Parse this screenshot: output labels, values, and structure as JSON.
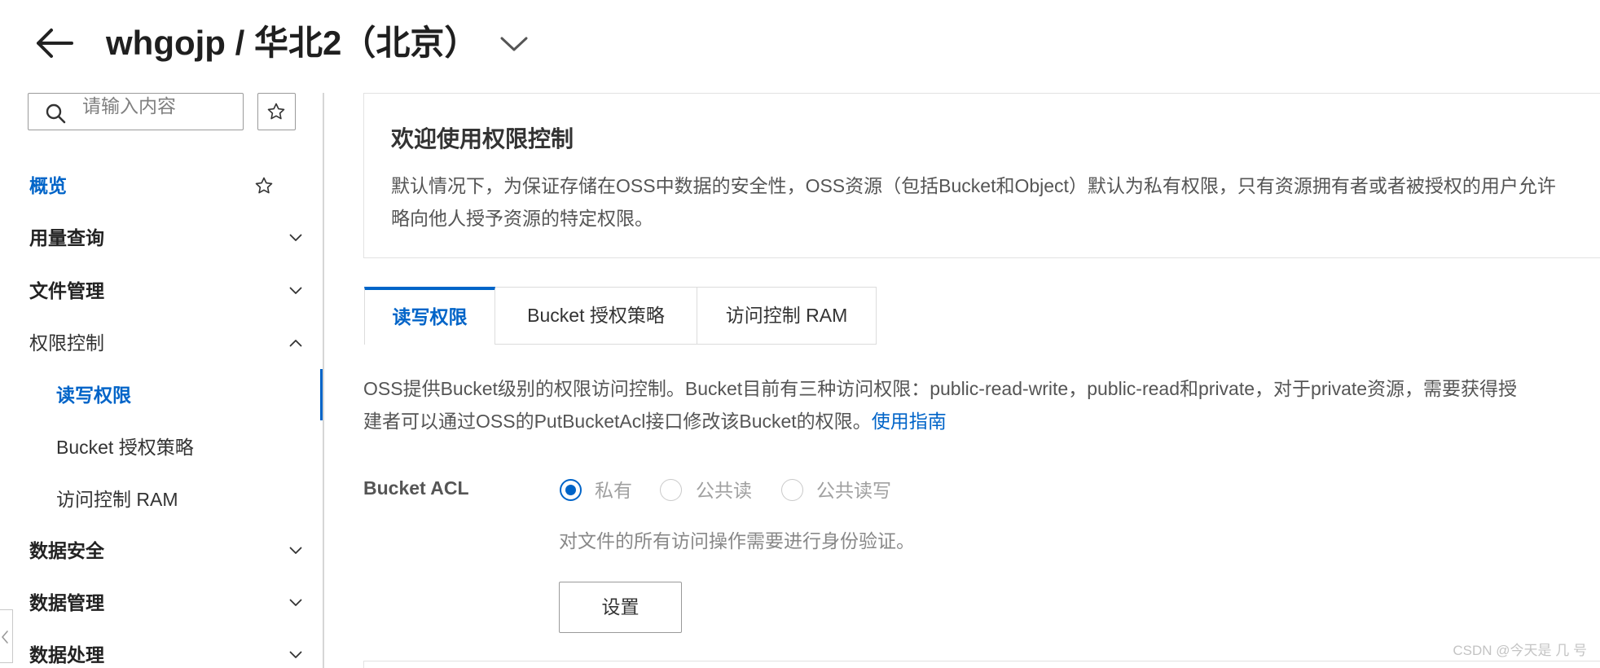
{
  "theme": {
    "accent": "#0064c8",
    "text": "#333333",
    "muted": "#999999",
    "border": "#dcdcdc"
  },
  "header": {
    "back_icon": "arrow-left-icon",
    "title": "whgojp / 华北2（北京）",
    "dropdown_icon": "chevron-down-icon"
  },
  "sidebar": {
    "search": {
      "placeholder": "请输入内容",
      "icon": "search-icon"
    },
    "favorite_icon": "star-icon",
    "items": [
      {
        "label": "概览",
        "icon": "star-icon",
        "active": true
      },
      {
        "label": "用量查询",
        "icon": "chevron-down-icon"
      },
      {
        "label": "文件管理",
        "icon": "chevron-down-icon"
      },
      {
        "label": "权限控制",
        "icon": "chevron-up-icon",
        "expanded": true,
        "children": [
          {
            "label": "读写权限",
            "active": true
          },
          {
            "label": "Bucket 授权策略",
            "active": false
          },
          {
            "label": "访问控制 RAM",
            "active": false
          }
        ]
      },
      {
        "label": "数据安全",
        "icon": "chevron-down-icon"
      },
      {
        "label": "数据管理",
        "icon": "chevron-down-icon"
      },
      {
        "label": "数据处理",
        "icon": "chevron-down-icon"
      }
    ],
    "collapse_icon": "chevron-left-icon"
  },
  "welcome": {
    "title": "欢迎使用权限控制",
    "lines": [
      "默认情况下，为保证存储在OSS中数据的安全性，OSS资源（包括Bucket和Object）默认为私有权限，只有资源拥有者或者被授权的用户允许",
      "略向他人授予资源的特定权限。"
    ]
  },
  "tabs": [
    {
      "label": "读写权限",
      "active": true
    },
    {
      "label": "Bucket 授权策略",
      "active": false
    },
    {
      "label": "访问控制 RAM",
      "active": false
    }
  ],
  "acl": {
    "description": [
      "OSS提供Bucket级别的权限访问控制。Bucket目前有三种访问权限：public-read-write，public-read和private，对于private资源，需要获得授",
      "建者可以通过OSS的PutBucketAcl接口修改该Bucket的权限。"
    ],
    "guide_link": "使用指南",
    "label": "Bucket ACL",
    "options": [
      {
        "label": "私有",
        "checked": true
      },
      {
        "label": "公共读",
        "checked": false
      },
      {
        "label": "公共读写",
        "checked": false
      }
    ],
    "hint": "对文件的所有访问操作需要进行身份验证。",
    "submit_label": "设置"
  },
  "watermark": "CSDN @今天是 几 号"
}
